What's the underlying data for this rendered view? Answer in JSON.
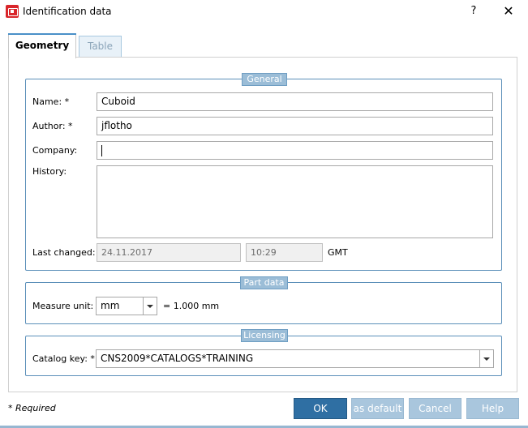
{
  "window": {
    "title": "Identification data",
    "help": "?",
    "close": "✕"
  },
  "tabs": [
    {
      "label": "Geometry",
      "active": true
    },
    {
      "label": "Table",
      "active": false
    }
  ],
  "general": {
    "legend": "General",
    "name_label": "Name: *",
    "name_value": "Cuboid",
    "author_label": "Author: *",
    "author_value": "jflotho",
    "company_label": "Company:",
    "company_value": "",
    "history_label": "History:",
    "history_value": "",
    "last_changed_label": "Last changed:",
    "date_value": "24.11.2017",
    "time_value": "10:29",
    "timezone": "GMT"
  },
  "part_data": {
    "legend": "Part data",
    "measure_unit_label": "Measure unit:",
    "measure_unit_value": "mm",
    "conversion": "=  1.000 mm"
  },
  "licensing": {
    "legend": "Licensing",
    "catalog_key_label": "Catalog key: *",
    "catalog_key_value": "CNS2009*CATALOGS*TRAINING"
  },
  "footer": {
    "required_note": "* Required",
    "ok": "OK",
    "as_default": "as default",
    "cancel": "Cancel",
    "help": "Help"
  },
  "colors": {
    "accent": "#2f6fa3",
    "group_border": "#5b8fb9",
    "group_label_bg": "#9bbdd7",
    "disabled_button": "#a9c6dd",
    "app_icon": "#d9262b"
  }
}
